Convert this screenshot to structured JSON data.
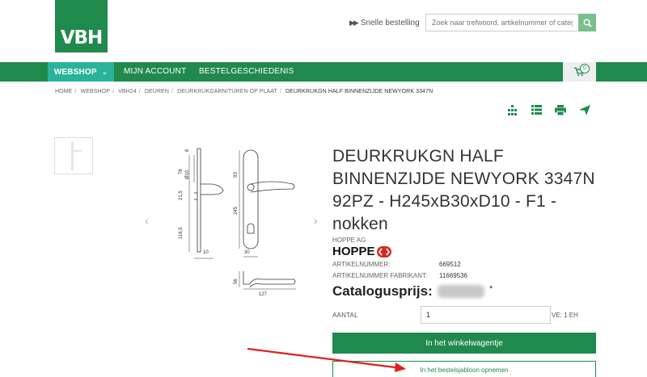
{
  "header": {
    "logo_text": "VBH",
    "quick_order_label": "Snelle bestelling",
    "search_placeholder": "Zoek naar trefwoord, artikelnummer of categorie..."
  },
  "nav": {
    "items": [
      {
        "label": "WEBSHOP"
      },
      {
        "label": "MIJN ACCOUNT"
      },
      {
        "label": "BESTELGESCHIEDENIS"
      }
    ],
    "cart_count": "0"
  },
  "breadcrumb": [
    "HOME",
    "WEBSHOP",
    "VBH24",
    "DEUREN",
    "DEURKRUKGARNITUREN OP PLAAT",
    "DEURKRUKGN HALF BINNENZIJDE NEWYORK 3347N"
  ],
  "tools": [
    "variants-icon",
    "list-icon",
    "print-icon",
    "send-icon"
  ],
  "drawing_labels": [
    "6",
    "78",
    "Ø10",
    "21,5",
    "93",
    "245",
    "116,5",
    "10",
    "30",
    "56",
    "127"
  ],
  "product": {
    "title": "DEURKRUKGN HALF BINNENZIJDE NEWYORK 3347N 92PZ - H245xB30xD10 - F1 - nokken",
    "brand": "HOPPE AG",
    "brand_logo_text": "HOPPE",
    "specs": [
      {
        "label": "ARTIKELNUMMER:",
        "value": "669512"
      },
      {
        "label": "ARTIKELNUMMER FABRIKANT:",
        "value": "11669536"
      }
    ],
    "price_label": "Catalogusprijs:",
    "price_star": "*",
    "qty_label": "AANTAL",
    "qty_value": "1",
    "unit": "VE: 1 EH",
    "add_to_cart": "In het winkelwagentje",
    "add_to_template": "In het bestelsjabloon opnemen"
  },
  "colors": {
    "brand_green": "#1f8a4c",
    "webshop_teal": "#2bb39a",
    "annotation_red": "#e0201e"
  }
}
